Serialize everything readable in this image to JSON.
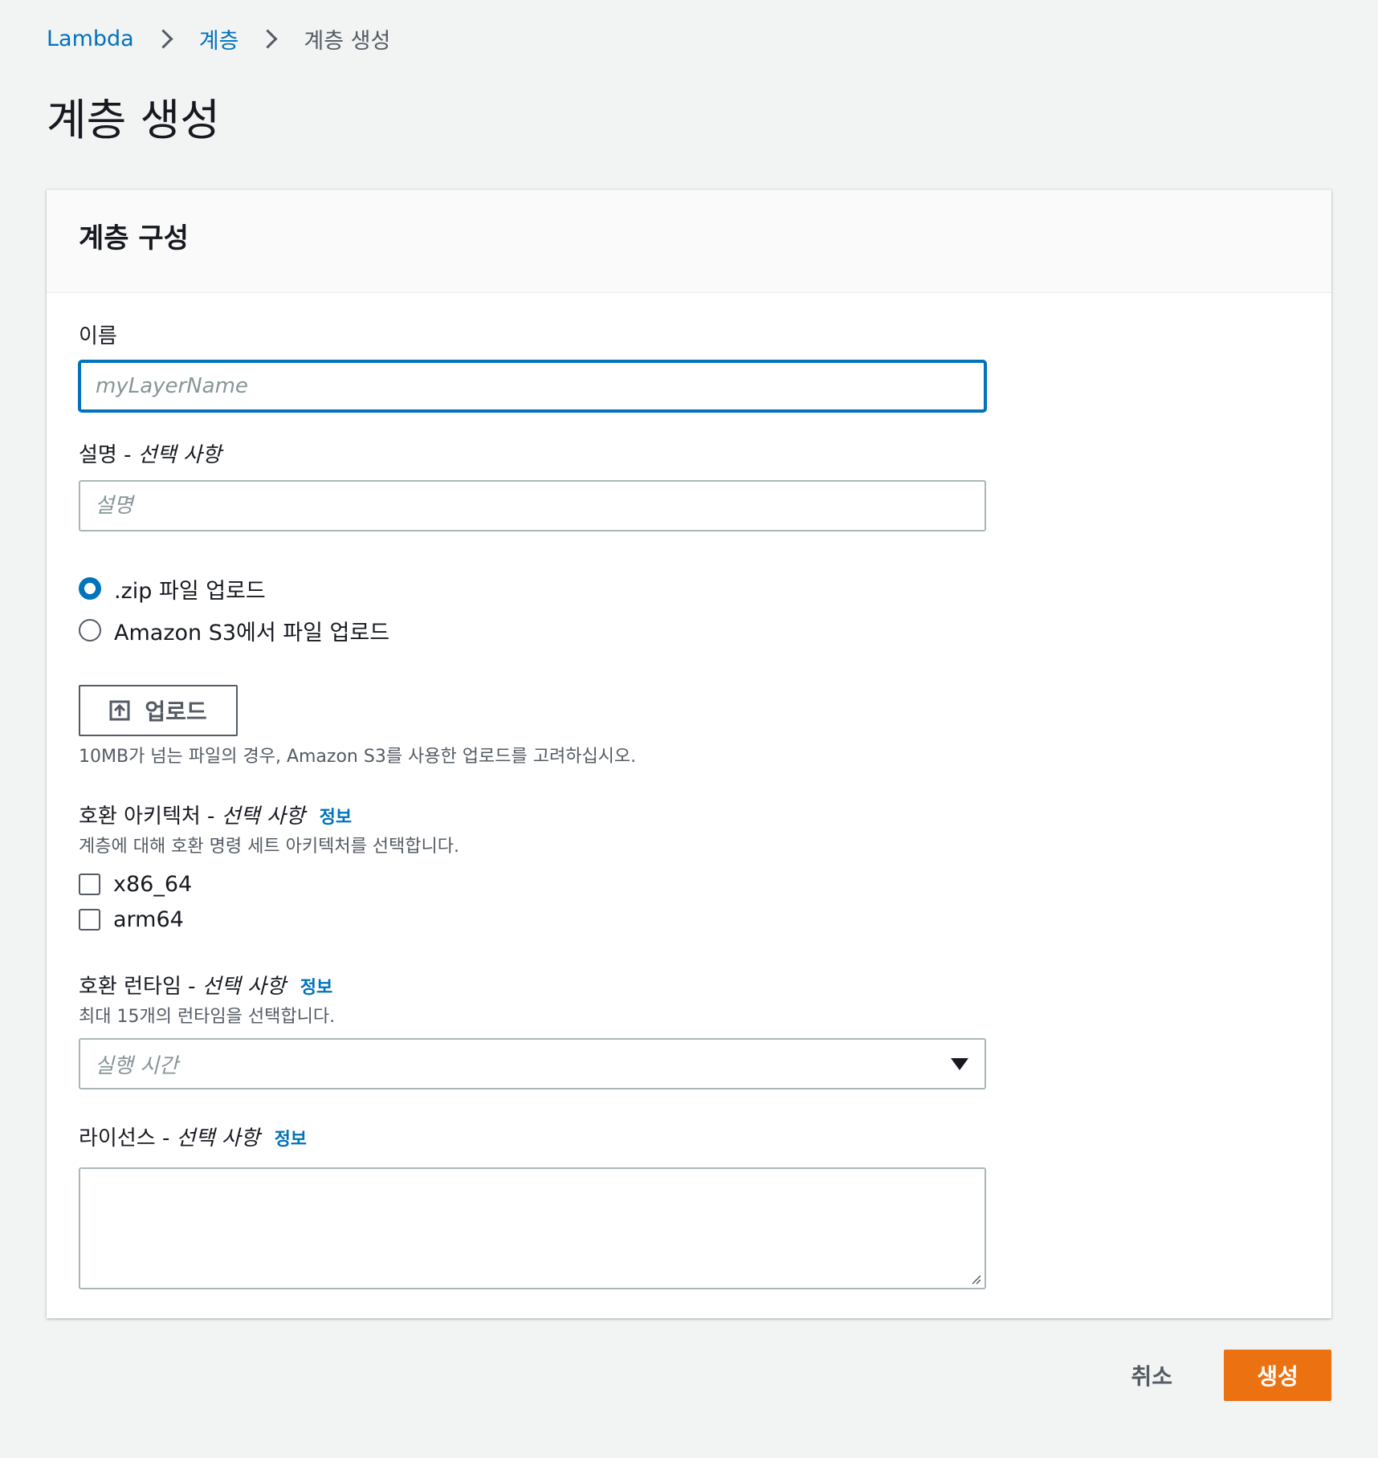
{
  "breadcrumb": {
    "items": [
      {
        "label": "Lambda"
      },
      {
        "label": "계층"
      },
      {
        "label": "계층 생성"
      }
    ]
  },
  "page": {
    "title": "계층 생성"
  },
  "panel": {
    "title": "계층 구성"
  },
  "name_field": {
    "label": "이름",
    "placeholder": "myLayerName",
    "value": ""
  },
  "description_field": {
    "label": "설명",
    "label_separator": " - ",
    "optional": "선택 사항",
    "placeholder": "설명",
    "value": ""
  },
  "upload_options": {
    "selected": "zip",
    "items": [
      {
        "id": "zip",
        "label": ".zip 파일 업로드"
      },
      {
        "id": "s3",
        "label": "Amazon S3에서 파일 업로드"
      }
    ]
  },
  "upload_button": {
    "label": "업로드",
    "icon": "upload-icon",
    "hint": "10MB가 넘는 파일의 경우, Amazon S3를 사용한 업로드를 고려하십시오."
  },
  "architectures": {
    "label": "호환 아키텍처",
    "label_separator": " - ",
    "optional": "선택 사항",
    "info": "정보",
    "hint": "계층에 대해 호환 명령 세트 아키텍처를 선택합니다.",
    "options": [
      {
        "label": "x86_64",
        "checked": false
      },
      {
        "label": "arm64",
        "checked": false
      }
    ]
  },
  "runtimes": {
    "label": "호환 런타임",
    "label_separator": " - ",
    "optional": "선택 사항",
    "info": "정보",
    "hint": "최대 15개의 런타임을 선택합니다.",
    "placeholder": "실행 시간",
    "icon": "caret-down-icon"
  },
  "license": {
    "label": "라이선스",
    "label_separator": " - ",
    "optional": "선택 사항",
    "info": "정보",
    "value": ""
  },
  "actions": {
    "cancel_label": "취소",
    "create_label": "생성"
  },
  "colors": {
    "link": "#0073bb",
    "primary_button": "#ec7211",
    "background": "#f2f3f3",
    "focus_border": "#0073bb"
  }
}
